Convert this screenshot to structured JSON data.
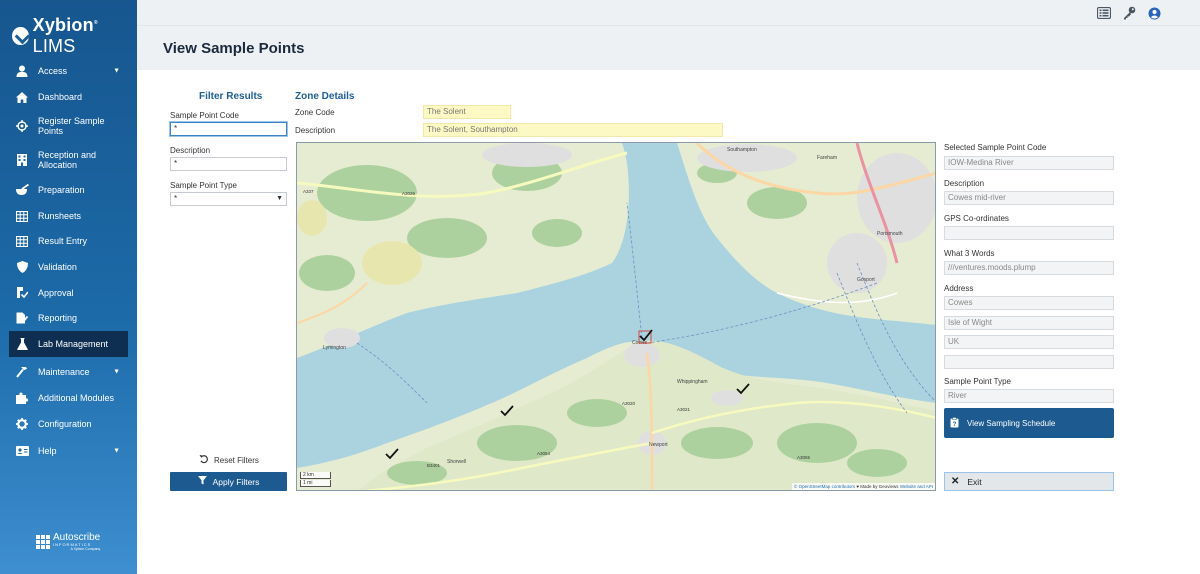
{
  "app": {
    "brand": "Xybion",
    "brand_suffix": "LIMS",
    "page_title": "View Sample Points"
  },
  "sidebar": {
    "items": [
      {
        "label": "Access",
        "icon": "user-icon",
        "has_caret": true
      },
      {
        "label": "Dashboard",
        "icon": "home-icon"
      },
      {
        "label": "Register Sample Points",
        "icon": "crosshair-icon"
      },
      {
        "label": "Reception and Allocation",
        "icon": "building-icon"
      },
      {
        "label": "Preparation",
        "icon": "mortar-icon"
      },
      {
        "label": "Runsheets",
        "icon": "table-icon"
      },
      {
        "label": "Result Entry",
        "icon": "table-icon"
      },
      {
        "label": "Validation",
        "icon": "shield-icon"
      },
      {
        "label": "Approval",
        "icon": "approval-icon"
      },
      {
        "label": "Reporting",
        "icon": "report-icon"
      },
      {
        "label": "Lab Management",
        "icon": "flask-icon",
        "active": true
      },
      {
        "label": "Maintenance",
        "icon": "hammer-icon",
        "has_caret": true
      },
      {
        "label": "Additional Modules",
        "icon": "puzzle-icon"
      },
      {
        "label": "Configuration",
        "icon": "gear-icon"
      },
      {
        "label": "Help",
        "icon": "id-card-icon",
        "has_caret": true
      }
    ],
    "footer": {
      "name": "Autoscribe",
      "sub": "INFORMATICS",
      "sub2": "A Xybion Company"
    }
  },
  "topbar": {
    "icons": [
      "list-icon",
      "key-icon",
      "user-circle-icon"
    ]
  },
  "filter": {
    "heading": "Filter Results",
    "sample_point_code_label": "Sample Point Code",
    "sample_point_code_value": "*",
    "description_label": "Description",
    "description_value": "*",
    "sample_point_type_label": "Sample Point Type",
    "sample_point_type_value": "*",
    "reset_label": "Reset Filters",
    "apply_label": "Apply Filters"
  },
  "zone": {
    "heading": "Zone Details",
    "zone_code_label": "Zone Code",
    "zone_code_value": "The Solent",
    "description_label": "Description",
    "description_value": "The Solent, Southampton"
  },
  "map": {
    "scale_km": "2 km",
    "scale_mi": "1 mi",
    "attribution_osm": "© OpenStreetMap contributors",
    "attribution_mid": " ♥ Made by Geoviews ",
    "attribution_api": "Website and API",
    "place_labels": [
      "Cowes",
      "Newport",
      "Lymington",
      "Portsmouth",
      "Gosport",
      "Fareham",
      "Southampton",
      "Whippingham",
      "Shorwell"
    ],
    "road_labels": [
      "A3020",
      "A3021",
      "A3054",
      "A3055",
      "B3401",
      "A337",
      "A3026"
    ],
    "colors": {
      "water": "#aad3df",
      "land": "#e6ecd1",
      "woods": "#add19e",
      "urban": "#e0dfdf"
    }
  },
  "selected": {
    "code_label": "Selected Sample Point Code",
    "code_value": "IOW-Medina River",
    "description_label": "Description",
    "description_value": "Cowes mid-river",
    "gps_label": "GPS Co-ordinates",
    "gps_value": "",
    "w3w_label": "What 3 Words",
    "w3w_value": "///ventures.moods.plump",
    "address_label": "Address",
    "address_lines": [
      "Cowes",
      "Isle of Wight",
      "UK",
      ""
    ],
    "type_label": "Sample Point Type",
    "type_value": "River",
    "schedule_label": "View Sampling Schedule",
    "exit_label": "Exit"
  }
}
